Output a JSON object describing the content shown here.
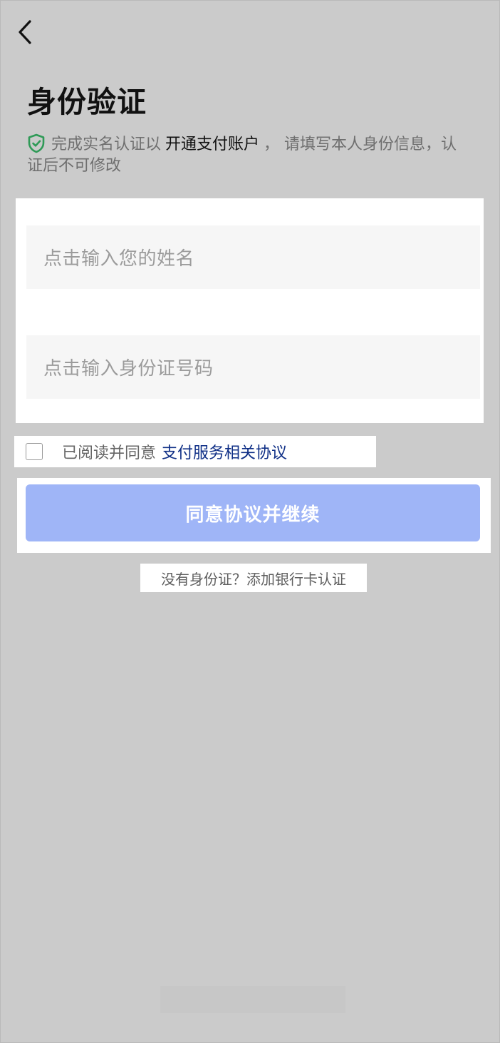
{
  "header": {
    "back_icon": "chevron-left-icon",
    "title": "身份验证"
  },
  "notice": {
    "icon": "shield-check-icon",
    "icon_color": "#2f9a57",
    "text_before": "完成实名认证以",
    "highlight": "开通支付账户",
    "text_after": "， 请填写本人身份信息，认证后不可修改"
  },
  "form": {
    "name_placeholder": "点击输入您的姓名",
    "id_placeholder": "点击输入身份证号码"
  },
  "agreement": {
    "checked": false,
    "text": "已阅读并同意",
    "link": "支付服务相关协议",
    "link_color": "#0f2f86"
  },
  "actions": {
    "continue_label": "同意协议并继续",
    "continue_color": "#9fb5f7",
    "alternative_label": "没有身份证？添加银行卡认证"
  }
}
